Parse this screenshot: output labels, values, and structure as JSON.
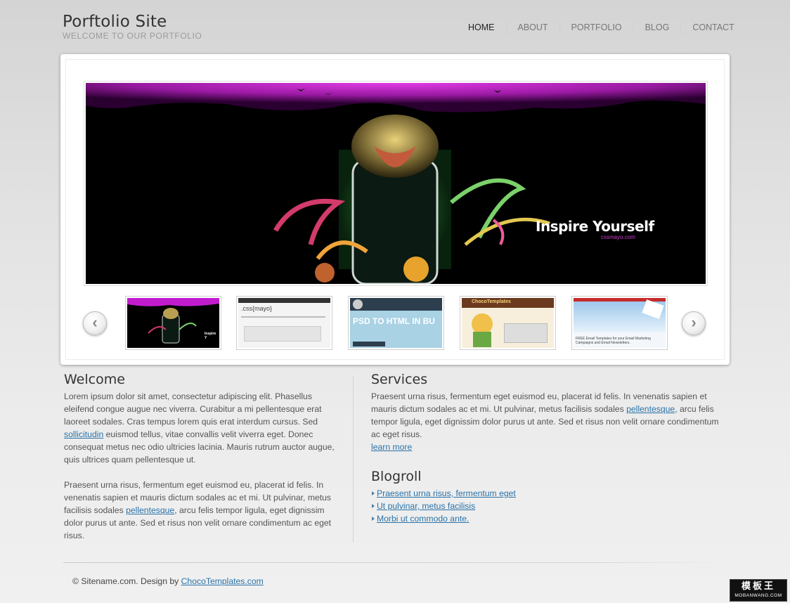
{
  "header": {
    "site_title": "Porftolio Site",
    "tagline": "WELCOME TO OUR PORTFOLIO"
  },
  "nav": {
    "items": [
      {
        "label": "HOME",
        "active": true
      },
      {
        "label": "ABOUT",
        "active": false
      },
      {
        "label": "PORTFOLIO",
        "active": false
      },
      {
        "label": "BLOG",
        "active": false
      },
      {
        "label": "CONTACT",
        "active": false
      }
    ]
  },
  "slider": {
    "caption": "Inspire Yourself",
    "caption_sub": "cssmayo.com",
    "prev_icon": "chevron-left-icon",
    "next_icon": "chevron-right-icon",
    "thumbs": [
      {
        "text": "Inspire Y"
      },
      {
        "text": ".css{mayo}"
      },
      {
        "text": "PSD TO HTML IN BU"
      },
      {
        "text": "ChocoTemplates"
      },
      {
        "text": "FREE Email Templates for your Email Marketing Campaigns and Email Newsletters."
      }
    ]
  },
  "welcome": {
    "title": "Welcome",
    "p1_before": "Lorem ipsum dolor sit amet, consectetur adipiscing elit. Phasellus eleifend congue augue nec viverra. Curabitur a mi pellentesque erat laoreet sodales. Cras tempus lorem quis erat interdum cursus. Sed ",
    "p1_link": "sollicitudin",
    "p1_after": " euismod tellus, vitae convallis velit viverra eget. Donec consequat metus nec odio ultricies lacinia. Mauris rutrum auctor augue, quis ultrices quam pellentesque ut.",
    "p2_before": "Praesent urna risus, fermentum eget euismod eu, placerat id felis. In venenatis sapien et mauris dictum sodales ac et mi. Ut pulvinar, metus facilisis sodales ",
    "p2_link": "pellentesque",
    "p2_after": ", arcu felis tempor ligula, eget dignissim dolor purus ut ante. Sed et risus non velit ornare condimentum ac eget risus."
  },
  "services": {
    "title": "Services",
    "p_before": "Praesent urna risus, fermentum eget euismod eu, placerat id felis. In venenatis sapien et mauris dictum sodales ac et mi. Ut pulvinar, metus facilisis sodales ",
    "p_link": "pellentesque",
    "p_after": ", arcu felis tempor ligula, eget dignissim dolor purus ut ante. Sed et risus non velit ornare condimentum ac eget risus.",
    "learn_more": "learn more"
  },
  "blogroll": {
    "title": "Blogroll",
    "items": [
      "Praesent urna risus, fermentum eget",
      "Ut pulvinar, metus facilisis",
      "Morbi ut commodo ante."
    ]
  },
  "footer": {
    "text": "© Sitename.com. Design by ",
    "link": "ChocoTemplates.com"
  },
  "badge": {
    "line1": "模板王",
    "line2": "MOBANWANG.COM"
  },
  "colors": {
    "link": "#2b73a8",
    "hero_magenta": "#c21ccf"
  }
}
